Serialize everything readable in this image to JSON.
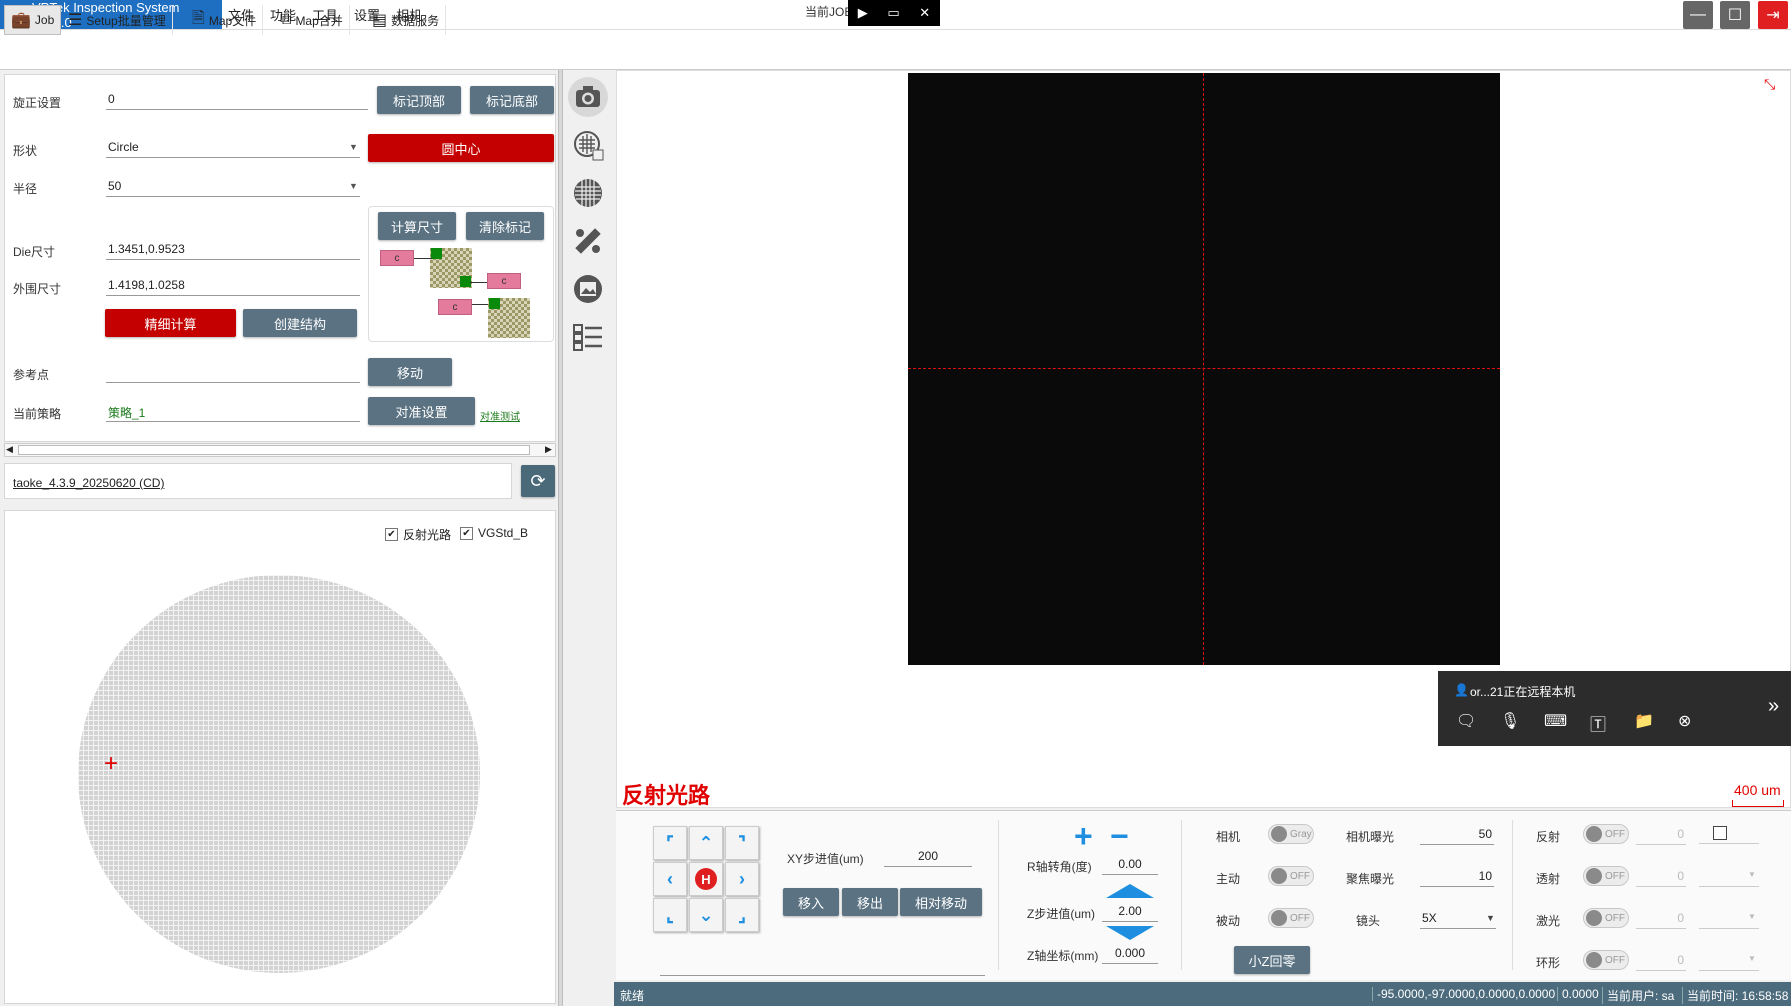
{
  "app": {
    "logo": "VP",
    "title": "VPTek Inspection System 1.0.0.0"
  },
  "menu": [
    "文件",
    "功能",
    "工具",
    "设置",
    "相机"
  ],
  "center_title": "当前JOB:..st (Grid)",
  "remote_controls": [
    "▶",
    "▭",
    "✕"
  ],
  "window_buttons": {
    "minimize": "—",
    "maximize": "☐",
    "exit": "⇥"
  },
  "toolbar": [
    "Job",
    "Setup批量管理",
    "Map文件",
    "Map合并",
    "数据服务"
  ],
  "form": {
    "rotation_label": "旋正设置",
    "rotation_value": "0",
    "mark_top": "标记顶部",
    "mark_bottom": "标记底部",
    "shape_label": "形状",
    "shape_value": "Circle",
    "circle_center": "圆中心",
    "radius_label": "半径",
    "radius_value": "50",
    "calc_size": "计算尺寸",
    "clear_mark": "清除标记",
    "die_label": "Die尺寸",
    "die_value": "1.3451,0.9523",
    "outer_label": "外围尺寸",
    "outer_value": "1.4198,1.0258",
    "fine_calc": "精细计算",
    "create_struct": "创建结构",
    "ref_label": "参考点",
    "ref_value": "",
    "move": "移动",
    "strategy_label": "当前策略",
    "strategy_value": "策略_1",
    "align_setup": "对准设置",
    "align_test": "对准测试",
    "chip_label": "c"
  },
  "file_ref": "taoke_4.3.9_20250620 (CD)",
  "wafer_checks": {
    "reflect": "反射光路",
    "vgstd": "VGStd_B"
  },
  "view": {
    "label": "反射光路",
    "scale": "400 um",
    "scale_color": "#e00000"
  },
  "remote_banner": {
    "text": "or...21正在远程本机",
    "expand": "»"
  },
  "jog": {
    "home": "H",
    "xy_step_label": "XY步进值(um)",
    "xy_step_value": "200",
    "move_in": "移入",
    "move_out": "移出",
    "relative_move": "相对移动"
  },
  "axis": {
    "r_label": "R轴转角(度)",
    "r_value": "0.00",
    "z_step_label": "Z步进值(um)",
    "z_step_value": "2.00",
    "z_coord_label": "Z轴坐标(mm)",
    "z_coord_value": "0.000"
  },
  "camera": {
    "camera_label": "相机",
    "camera_toggle": "Gray",
    "active_label": "主动",
    "passive_label": "被动",
    "off": "OFF",
    "exposure_label": "相机曝光",
    "exposure_value": "50",
    "focus_label": "聚焦曝光",
    "focus_value": "10",
    "lens_label": "镜头",
    "lens_value": "5X",
    "small_z_zero": "小Z回零"
  },
  "lights": [
    {
      "label": "反射",
      "value": "0"
    },
    {
      "label": "透射",
      "value": "0"
    },
    {
      "label": "激光",
      "value": "0"
    },
    {
      "label": "环形",
      "value": "0"
    }
  ],
  "status": {
    "ready": "就绪",
    "coords": "-95.0000,-97.0000,0.0000,0.0000",
    "value": "0.0000",
    "user": "当前用户: sa",
    "time": "当前时间: 16:58:58"
  },
  "colors": {
    "accent": "#1e6fc2",
    "button": "#5a7282",
    "danger": "#c40000",
    "statusbar": "#4c6b7d"
  }
}
